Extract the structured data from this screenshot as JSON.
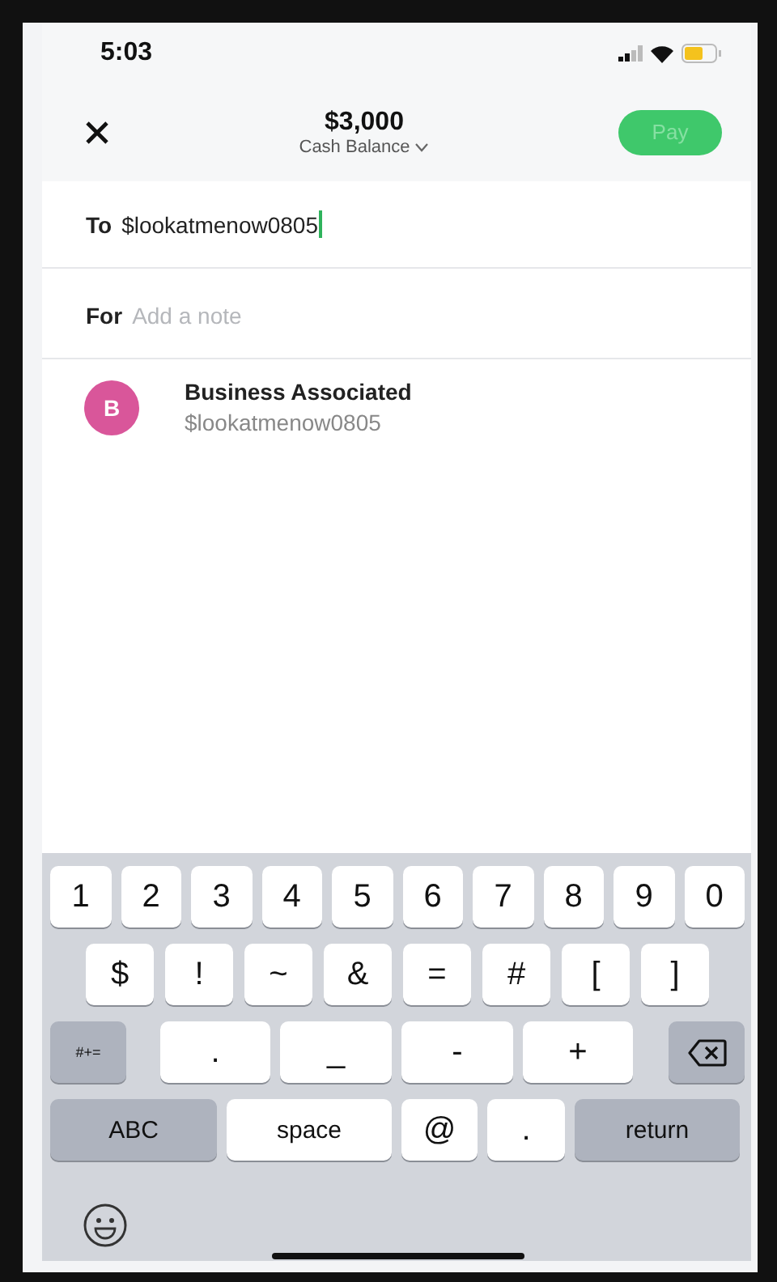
{
  "status_bar": {
    "time": "5:03"
  },
  "header": {
    "amount": "$3,000",
    "balance_label": "Cash Balance",
    "pay_button": {
      "label": "Pay",
      "disabled": true
    }
  },
  "to_field": {
    "label": "To",
    "value": "$lookatmenow0805",
    "focused": true
  },
  "for_field": {
    "label": "For",
    "placeholder": "Add a note"
  },
  "suggestions": [
    {
      "initial": "B",
      "color": "#d9569a",
      "name": "Business Associated",
      "handle": "$lookatmenow0805"
    }
  ],
  "keyboard": {
    "rows": [
      {
        "keys": [
          {
            "kind": "char",
            "label": "1"
          },
          {
            "kind": "char",
            "label": "2"
          },
          {
            "kind": "char",
            "label": "3"
          },
          {
            "kind": "char",
            "label": "4"
          },
          {
            "kind": "char",
            "label": "5"
          },
          {
            "kind": "char",
            "label": "6"
          },
          {
            "kind": "char",
            "label": "7"
          },
          {
            "kind": "char",
            "label": "8"
          },
          {
            "kind": "char",
            "label": "9"
          },
          {
            "kind": "char",
            "label": "0"
          }
        ]
      },
      {
        "keys": [
          {
            "kind": "char",
            "label": "$"
          },
          {
            "kind": "char",
            "label": "!"
          },
          {
            "kind": "char",
            "label": "~"
          },
          {
            "kind": "char",
            "label": "&"
          },
          {
            "kind": "char",
            "label": "="
          },
          {
            "kind": "char",
            "label": "#"
          },
          {
            "kind": "char",
            "label": "["
          },
          {
            "kind": "char",
            "label": "]"
          }
        ]
      },
      {
        "keys": [
          {
            "kind": "mode",
            "label": "#+="
          },
          {
            "kind": "char",
            "label": "."
          },
          {
            "kind": "char",
            "label": "_"
          },
          {
            "kind": "char",
            "label": "-"
          },
          {
            "kind": "char",
            "label": "+"
          },
          {
            "kind": "delete"
          }
        ]
      },
      {
        "keys": [
          {
            "kind": "mode",
            "label": "ABC"
          },
          {
            "kind": "space",
            "label": "space"
          },
          {
            "kind": "char",
            "label": "@"
          },
          {
            "kind": "char",
            "label": "."
          },
          {
            "kind": "return",
            "label": "return"
          }
        ]
      }
    ]
  }
}
